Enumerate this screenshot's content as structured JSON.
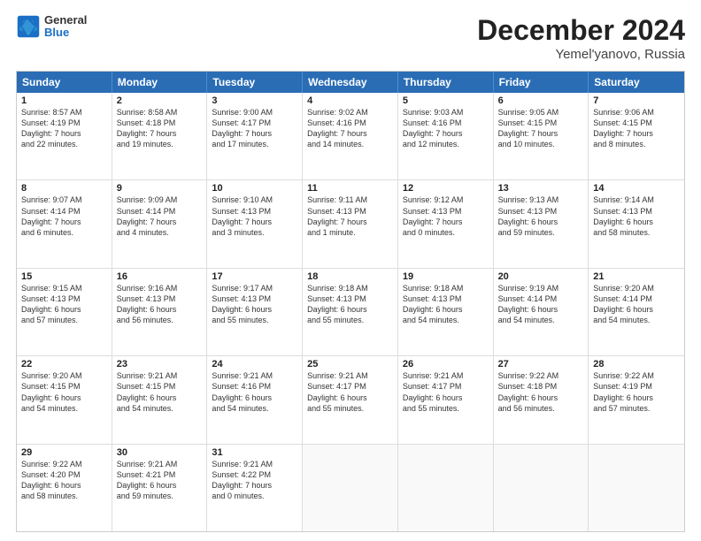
{
  "header": {
    "logo_general": "General",
    "logo_blue": "Blue",
    "month_title": "December 2024",
    "location": "Yemel'yanovo, Russia"
  },
  "days_of_week": [
    "Sunday",
    "Monday",
    "Tuesday",
    "Wednesday",
    "Thursday",
    "Friday",
    "Saturday"
  ],
  "weeks": [
    [
      {
        "day": "1",
        "info": "Sunrise: 8:57 AM\nSunset: 4:19 PM\nDaylight: 7 hours\nand 22 minutes."
      },
      {
        "day": "2",
        "info": "Sunrise: 8:58 AM\nSunset: 4:18 PM\nDaylight: 7 hours\nand 19 minutes."
      },
      {
        "day": "3",
        "info": "Sunrise: 9:00 AM\nSunset: 4:17 PM\nDaylight: 7 hours\nand 17 minutes."
      },
      {
        "day": "4",
        "info": "Sunrise: 9:02 AM\nSunset: 4:16 PM\nDaylight: 7 hours\nand 14 minutes."
      },
      {
        "day": "5",
        "info": "Sunrise: 9:03 AM\nSunset: 4:16 PM\nDaylight: 7 hours\nand 12 minutes."
      },
      {
        "day": "6",
        "info": "Sunrise: 9:05 AM\nSunset: 4:15 PM\nDaylight: 7 hours\nand 10 minutes."
      },
      {
        "day": "7",
        "info": "Sunrise: 9:06 AM\nSunset: 4:15 PM\nDaylight: 7 hours\nand 8 minutes."
      }
    ],
    [
      {
        "day": "8",
        "info": "Sunrise: 9:07 AM\nSunset: 4:14 PM\nDaylight: 7 hours\nand 6 minutes."
      },
      {
        "day": "9",
        "info": "Sunrise: 9:09 AM\nSunset: 4:14 PM\nDaylight: 7 hours\nand 4 minutes."
      },
      {
        "day": "10",
        "info": "Sunrise: 9:10 AM\nSunset: 4:13 PM\nDaylight: 7 hours\nand 3 minutes."
      },
      {
        "day": "11",
        "info": "Sunrise: 9:11 AM\nSunset: 4:13 PM\nDaylight: 7 hours\nand 1 minute."
      },
      {
        "day": "12",
        "info": "Sunrise: 9:12 AM\nSunset: 4:13 PM\nDaylight: 7 hours\nand 0 minutes."
      },
      {
        "day": "13",
        "info": "Sunrise: 9:13 AM\nSunset: 4:13 PM\nDaylight: 6 hours\nand 59 minutes."
      },
      {
        "day": "14",
        "info": "Sunrise: 9:14 AM\nSunset: 4:13 PM\nDaylight: 6 hours\nand 58 minutes."
      }
    ],
    [
      {
        "day": "15",
        "info": "Sunrise: 9:15 AM\nSunset: 4:13 PM\nDaylight: 6 hours\nand 57 minutes."
      },
      {
        "day": "16",
        "info": "Sunrise: 9:16 AM\nSunset: 4:13 PM\nDaylight: 6 hours\nand 56 minutes."
      },
      {
        "day": "17",
        "info": "Sunrise: 9:17 AM\nSunset: 4:13 PM\nDaylight: 6 hours\nand 55 minutes."
      },
      {
        "day": "18",
        "info": "Sunrise: 9:18 AM\nSunset: 4:13 PM\nDaylight: 6 hours\nand 55 minutes."
      },
      {
        "day": "19",
        "info": "Sunrise: 9:18 AM\nSunset: 4:13 PM\nDaylight: 6 hours\nand 54 minutes."
      },
      {
        "day": "20",
        "info": "Sunrise: 9:19 AM\nSunset: 4:14 PM\nDaylight: 6 hours\nand 54 minutes."
      },
      {
        "day": "21",
        "info": "Sunrise: 9:20 AM\nSunset: 4:14 PM\nDaylight: 6 hours\nand 54 minutes."
      }
    ],
    [
      {
        "day": "22",
        "info": "Sunrise: 9:20 AM\nSunset: 4:15 PM\nDaylight: 6 hours\nand 54 minutes."
      },
      {
        "day": "23",
        "info": "Sunrise: 9:21 AM\nSunset: 4:15 PM\nDaylight: 6 hours\nand 54 minutes."
      },
      {
        "day": "24",
        "info": "Sunrise: 9:21 AM\nSunset: 4:16 PM\nDaylight: 6 hours\nand 54 minutes."
      },
      {
        "day": "25",
        "info": "Sunrise: 9:21 AM\nSunset: 4:17 PM\nDaylight: 6 hours\nand 55 minutes."
      },
      {
        "day": "26",
        "info": "Sunrise: 9:21 AM\nSunset: 4:17 PM\nDaylight: 6 hours\nand 55 minutes."
      },
      {
        "day": "27",
        "info": "Sunrise: 9:22 AM\nSunset: 4:18 PM\nDaylight: 6 hours\nand 56 minutes."
      },
      {
        "day": "28",
        "info": "Sunrise: 9:22 AM\nSunset: 4:19 PM\nDaylight: 6 hours\nand 57 minutes."
      }
    ],
    [
      {
        "day": "29",
        "info": "Sunrise: 9:22 AM\nSunset: 4:20 PM\nDaylight: 6 hours\nand 58 minutes."
      },
      {
        "day": "30",
        "info": "Sunrise: 9:21 AM\nSunset: 4:21 PM\nDaylight: 6 hours\nand 59 minutes."
      },
      {
        "day": "31",
        "info": "Sunrise: 9:21 AM\nSunset: 4:22 PM\nDaylight: 7 hours\nand 0 minutes."
      },
      {
        "day": "",
        "info": ""
      },
      {
        "day": "",
        "info": ""
      },
      {
        "day": "",
        "info": ""
      },
      {
        "day": "",
        "info": ""
      }
    ]
  ]
}
